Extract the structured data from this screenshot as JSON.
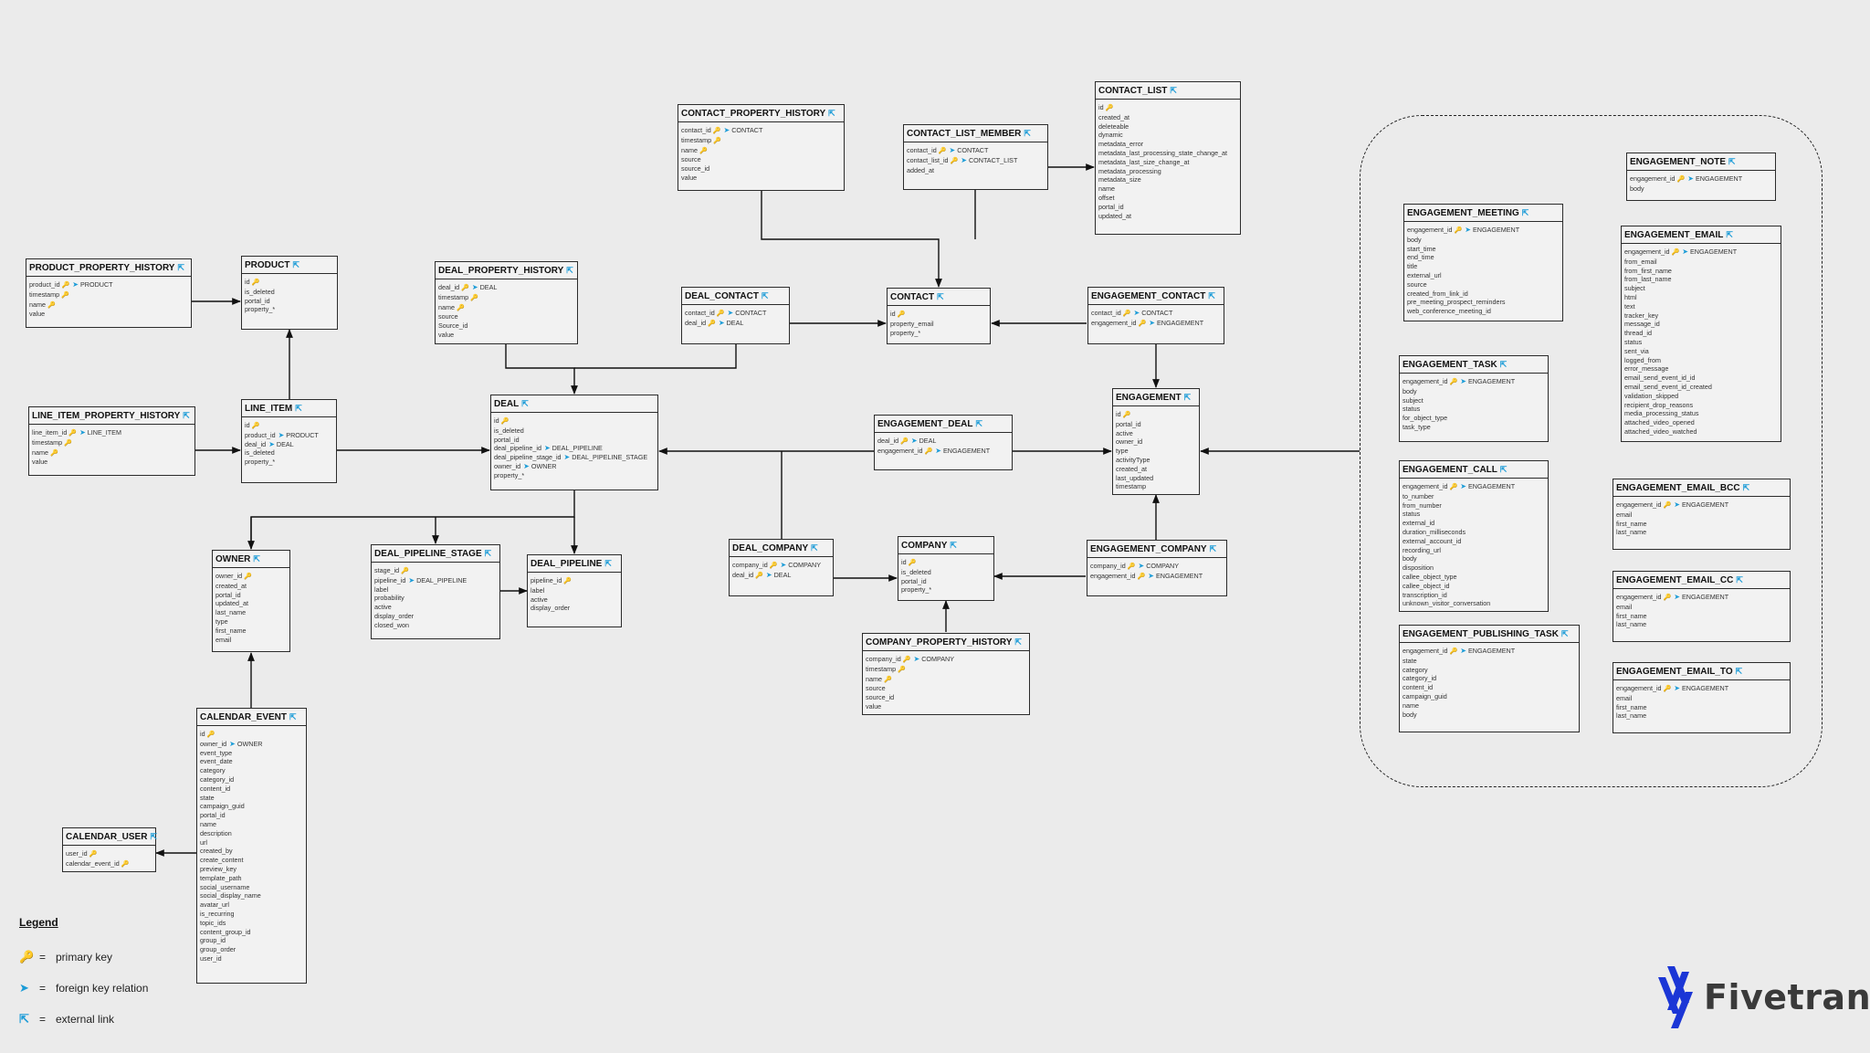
{
  "entities": [
    {
      "name": "CONTACT_PROPERTY_HISTORY",
      "fields": [
        {
          "n": "contact_id",
          "pk": true,
          "fk": "CONTACT"
        },
        {
          "n": "timestamp",
          "pk": true
        },
        {
          "n": "name",
          "pk": true
        },
        {
          "n": "source"
        },
        {
          "n": "source_id"
        },
        {
          "n": "value"
        }
      ]
    },
    {
      "name": "CONTACT_LIST_MEMBER",
      "fields": [
        {
          "n": "contact_id",
          "pk": true,
          "fk": "CONTACT"
        },
        {
          "n": "contact_list_id",
          "pk": true,
          "fk": "CONTACT_LIST"
        },
        {
          "n": "added_at"
        }
      ]
    },
    {
      "name": "CONTACT_LIST",
      "fields": [
        {
          "n": "id",
          "pk": true
        },
        {
          "n": "created_at"
        },
        {
          "n": "deleteable"
        },
        {
          "n": "dynamic"
        },
        {
          "n": "metadata_error"
        },
        {
          "n": "metadata_last_processing_state_change_at"
        },
        {
          "n": "metadata_last_size_change_at"
        },
        {
          "n": "metadata_processing"
        },
        {
          "n": "metadata_size"
        },
        {
          "n": "name"
        },
        {
          "n": "offset"
        },
        {
          "n": "portal_id"
        },
        {
          "n": "updated_at"
        }
      ]
    },
    {
      "name": "PRODUCT_PROPERTY_HISTORY",
      "fields": [
        {
          "n": "product_id",
          "pk": true,
          "fk": "PRODUCT"
        },
        {
          "n": "timestamp",
          "pk": true
        },
        {
          "n": "name",
          "pk": true
        },
        {
          "n": "value"
        }
      ]
    },
    {
      "name": "PRODUCT",
      "fields": [
        {
          "n": "id",
          "pk": true
        },
        {
          "n": "is_deleted"
        },
        {
          "n": "portal_id"
        },
        {
          "n": "property_*"
        }
      ]
    },
    {
      "name": "DEAL_PROPERTY_HISTORY",
      "fields": [
        {
          "n": "deal_id",
          "pk": true,
          "fk": "DEAL"
        },
        {
          "n": "timestamp",
          "pk": true
        },
        {
          "n": "name",
          "pk": true
        },
        {
          "n": "source"
        },
        {
          "n": "Source_id"
        },
        {
          "n": "value"
        }
      ]
    },
    {
      "name": "DEAL_CONTACT",
      "fields": [
        {
          "n": "contact_id",
          "pk": true,
          "fk": "CONTACT"
        },
        {
          "n": "deal_id",
          "pk": true,
          "fk": "DEAL"
        }
      ]
    },
    {
      "name": "CONTACT",
      "fields": [
        {
          "n": "id",
          "pk": true
        },
        {
          "n": "property_email"
        },
        {
          "n": "property_*"
        }
      ]
    },
    {
      "name": "ENGAGEMENT_CONTACT",
      "fields": [
        {
          "n": "contact_id",
          "pk": true,
          "fk": "CONTACT"
        },
        {
          "n": "engagement_id",
          "pk": true,
          "fk": "ENGAGEMENT"
        }
      ]
    },
    {
      "name": "LINE_ITEM_PROPERTY_HISTORY",
      "fields": [
        {
          "n": "line_item_id",
          "pk": true,
          "fk": "LINE_ITEM"
        },
        {
          "n": "timestamp",
          "pk": true
        },
        {
          "n": "name",
          "pk": true
        },
        {
          "n": "value"
        }
      ]
    },
    {
      "name": "LINE_ITEM",
      "fields": [
        {
          "n": "id",
          "pk": true
        },
        {
          "n": "product_id",
          "fk": "PRODUCT"
        },
        {
          "n": "deal_id",
          "fk": "DEAL"
        },
        {
          "n": "is_deleted"
        },
        {
          "n": "property_*"
        }
      ]
    },
    {
      "name": "DEAL",
      "fields": [
        {
          "n": "id",
          "pk": true
        },
        {
          "n": "is_deleted"
        },
        {
          "n": "portal_id"
        },
        {
          "n": "deal_pipeline_id",
          "fk": "DEAL_PIPELINE"
        },
        {
          "n": "deal_pipeline_stage_id",
          "fk": "DEAL_PIPELINE_STAGE"
        },
        {
          "n": "owner_id",
          "fk": "OWNER"
        },
        {
          "n": "property_*"
        }
      ]
    },
    {
      "name": "ENGAGEMENT_DEAL",
      "fields": [
        {
          "n": "deal_id",
          "pk": true,
          "fk": "DEAL"
        },
        {
          "n": "engagement_id",
          "pk": true,
          "fk": "ENGAGEMENT"
        }
      ]
    },
    {
      "name": "ENGAGEMENT",
      "fields": [
        {
          "n": "id",
          "pk": true
        },
        {
          "n": "portal_id"
        },
        {
          "n": "active"
        },
        {
          "n": "owner_id"
        },
        {
          "n": "type"
        },
        {
          "n": "activityType"
        },
        {
          "n": "created_at"
        },
        {
          "n": "last_updated"
        },
        {
          "n": "timestamp"
        }
      ]
    },
    {
      "name": "OWNER",
      "fields": [
        {
          "n": "owner_id",
          "pk": true
        },
        {
          "n": "created_at"
        },
        {
          "n": "portal_id"
        },
        {
          "n": "updated_at"
        },
        {
          "n": "last_name"
        },
        {
          "n": "type"
        },
        {
          "n": "first_name"
        },
        {
          "n": "email"
        }
      ]
    },
    {
      "name": "DEAL_PIPELINE_STAGE",
      "fields": [
        {
          "n": "stage_id",
          "pk": true
        },
        {
          "n": "pipeline_id",
          "fk": "DEAL_PIPELINE"
        },
        {
          "n": "label"
        },
        {
          "n": "probability"
        },
        {
          "n": "active"
        },
        {
          "n": "display_order"
        },
        {
          "n": "closed_won"
        }
      ]
    },
    {
      "name": "DEAL_PIPELINE",
      "fields": [
        {
          "n": "pipeline_id",
          "pk": true
        },
        {
          "n": "label"
        },
        {
          "n": "active"
        },
        {
          "n": "display_order"
        }
      ]
    },
    {
      "name": "DEAL_COMPANY",
      "fields": [
        {
          "n": "company_id",
          "pk": true,
          "fk": "COMPANY"
        },
        {
          "n": "deal_id",
          "pk": true,
          "fk": "DEAL"
        }
      ]
    },
    {
      "name": "COMPANY",
      "fields": [
        {
          "n": "id",
          "pk": true
        },
        {
          "n": "is_deleted"
        },
        {
          "n": "portal_id"
        },
        {
          "n": "property_*"
        }
      ]
    },
    {
      "name": "ENGAGEMENT_COMPANY",
      "fields": [
        {
          "n": "company_id",
          "pk": true,
          "fk": "COMPANY"
        },
        {
          "n": "engagement_id",
          "pk": true,
          "fk": "ENGAGEMENT"
        }
      ]
    },
    {
      "name": "COMPANY_PROPERTY_HISTORY",
      "fields": [
        {
          "n": "company_id",
          "pk": true,
          "fk": "COMPANY"
        },
        {
          "n": "timestamp",
          "pk": true
        },
        {
          "n": "name",
          "pk": true
        },
        {
          "n": "source"
        },
        {
          "n": "source_id"
        },
        {
          "n": "value"
        }
      ]
    },
    {
      "name": "CALENDAR_EVENT",
      "fields": [
        {
          "n": "id",
          "pk": true
        },
        {
          "n": "owner_id",
          "fk": "OWNER"
        },
        {
          "n": "event_type"
        },
        {
          "n": "event_date"
        },
        {
          "n": "category"
        },
        {
          "n": "category_id"
        },
        {
          "n": "content_id"
        },
        {
          "n": "state"
        },
        {
          "n": "campaign_guid"
        },
        {
          "n": "portal_id"
        },
        {
          "n": "name"
        },
        {
          "n": "description"
        },
        {
          "n": "url"
        },
        {
          "n": "created_by"
        },
        {
          "n": "create_content"
        },
        {
          "n": "preview_key"
        },
        {
          "n": "template_path"
        },
        {
          "n": "social_username"
        },
        {
          "n": "social_display_name"
        },
        {
          "n": "avatar_url"
        },
        {
          "n": "is_recurring"
        },
        {
          "n": "topic_ids"
        },
        {
          "n": "content_group_id"
        },
        {
          "n": "group_id"
        },
        {
          "n": "group_order"
        },
        {
          "n": "user_id"
        }
      ]
    },
    {
      "name": "CALENDAR_USER",
      "fields": [
        {
          "n": "user_id",
          "pk": true
        },
        {
          "n": "calendar_event_id",
          "pk": true
        }
      ]
    },
    {
      "name": "ENGAGEMENT_NOTE",
      "fields": [
        {
          "n": "engagement_id",
          "pk": true,
          "fk": "ENGAGEMENT"
        },
        {
          "n": "body"
        }
      ]
    },
    {
      "name": "ENGAGEMENT_MEETING",
      "fields": [
        {
          "n": "engagement_id",
          "pk": true,
          "fk": "ENGAGEMENT"
        },
        {
          "n": "body"
        },
        {
          "n": "start_time"
        },
        {
          "n": "end_time"
        },
        {
          "n": "title"
        },
        {
          "n": "external_url"
        },
        {
          "n": "source"
        },
        {
          "n": "created_from_link_id"
        },
        {
          "n": "pre_meeting_prospect_reminders"
        },
        {
          "n": "web_conference_meeting_id"
        }
      ]
    },
    {
      "name": "ENGAGEMENT_EMAIL",
      "fields": [
        {
          "n": "engagement_id",
          "pk": true,
          "fk": "ENGAGEMENT"
        },
        {
          "n": "from_email"
        },
        {
          "n": "from_first_name"
        },
        {
          "n": "from_last_name"
        },
        {
          "n": "subject"
        },
        {
          "n": "html"
        },
        {
          "n": "text"
        },
        {
          "n": "tracker_key"
        },
        {
          "n": "message_id"
        },
        {
          "n": "thread_id"
        },
        {
          "n": "status"
        },
        {
          "n": "sent_via"
        },
        {
          "n": "logged_from"
        },
        {
          "n": "error_message"
        },
        {
          "n": "email_send_event_id_id"
        },
        {
          "n": "email_send_event_id_created"
        },
        {
          "n": "validation_skipped"
        },
        {
          "n": "recipient_drop_reasons"
        },
        {
          "n": "media_processing_status"
        },
        {
          "n": "attached_video_opened"
        },
        {
          "n": "attached_video_watched"
        }
      ]
    },
    {
      "name": "ENGAGEMENT_TASK",
      "fields": [
        {
          "n": "engagement_id",
          "pk": true,
          "fk": "ENGAGEMENT"
        },
        {
          "n": "body"
        },
        {
          "n": "subject"
        },
        {
          "n": "status"
        },
        {
          "n": "for_object_type"
        },
        {
          "n": "task_type"
        }
      ]
    },
    {
      "name": "ENGAGEMENT_CALL",
      "fields": [
        {
          "n": "engagement_id",
          "pk": true,
          "fk": "ENGAGEMENT"
        },
        {
          "n": "to_number"
        },
        {
          "n": "from_number"
        },
        {
          "n": "status"
        },
        {
          "n": "external_id"
        },
        {
          "n": "duration_milliseconds"
        },
        {
          "n": "external_account_id"
        },
        {
          "n": "recording_url"
        },
        {
          "n": "body"
        },
        {
          "n": "disposition"
        },
        {
          "n": "callee_object_type"
        },
        {
          "n": "callee_object_id"
        },
        {
          "n": "transcription_id"
        },
        {
          "n": "unknown_visitor_conversation"
        }
      ]
    },
    {
      "name": "ENGAGEMENT_EMAIL_BCC",
      "fields": [
        {
          "n": "engagement_id",
          "pk": true,
          "fk": "ENGAGEMENT"
        },
        {
          "n": "email"
        },
        {
          "n": "first_name"
        },
        {
          "n": "last_name"
        }
      ]
    },
    {
      "name": "ENGAGEMENT_EMAIL_CC",
      "fields": [
        {
          "n": "engagement_id",
          "pk": true,
          "fk": "ENGAGEMENT"
        },
        {
          "n": "email"
        },
        {
          "n": "first_name"
        },
        {
          "n": "last_name"
        }
      ]
    },
    {
      "name": "ENGAGEMENT_PUBLISHING_TASK",
      "fields": [
        {
          "n": "engagement_id",
          "pk": true,
          "fk": "ENGAGEMENT"
        },
        {
          "n": "state"
        },
        {
          "n": "category"
        },
        {
          "n": "category_id"
        },
        {
          "n": "content_id"
        },
        {
          "n": "campaign_guid"
        },
        {
          "n": "name"
        },
        {
          "n": "body"
        }
      ]
    },
    {
      "name": "ENGAGEMENT_EMAIL_TO",
      "fields": [
        {
          "n": "engagement_id",
          "pk": true,
          "fk": "ENGAGEMENT"
        },
        {
          "n": "email"
        },
        {
          "n": "first_name"
        },
        {
          "n": "last_name"
        }
      ]
    }
  ],
  "legend": {
    "title": "Legend",
    "eq": "=",
    "primary_key": "primary key",
    "foreign_key": "foreign key relation",
    "external_link": "external link"
  },
  "logo": {
    "text": "Fivetran"
  },
  "colors": {
    "background": "#ebebeb",
    "box": "#f2f2f2",
    "border": "#2b2b2b",
    "key": "#d5a021",
    "link": "#1a9bd7"
  }
}
